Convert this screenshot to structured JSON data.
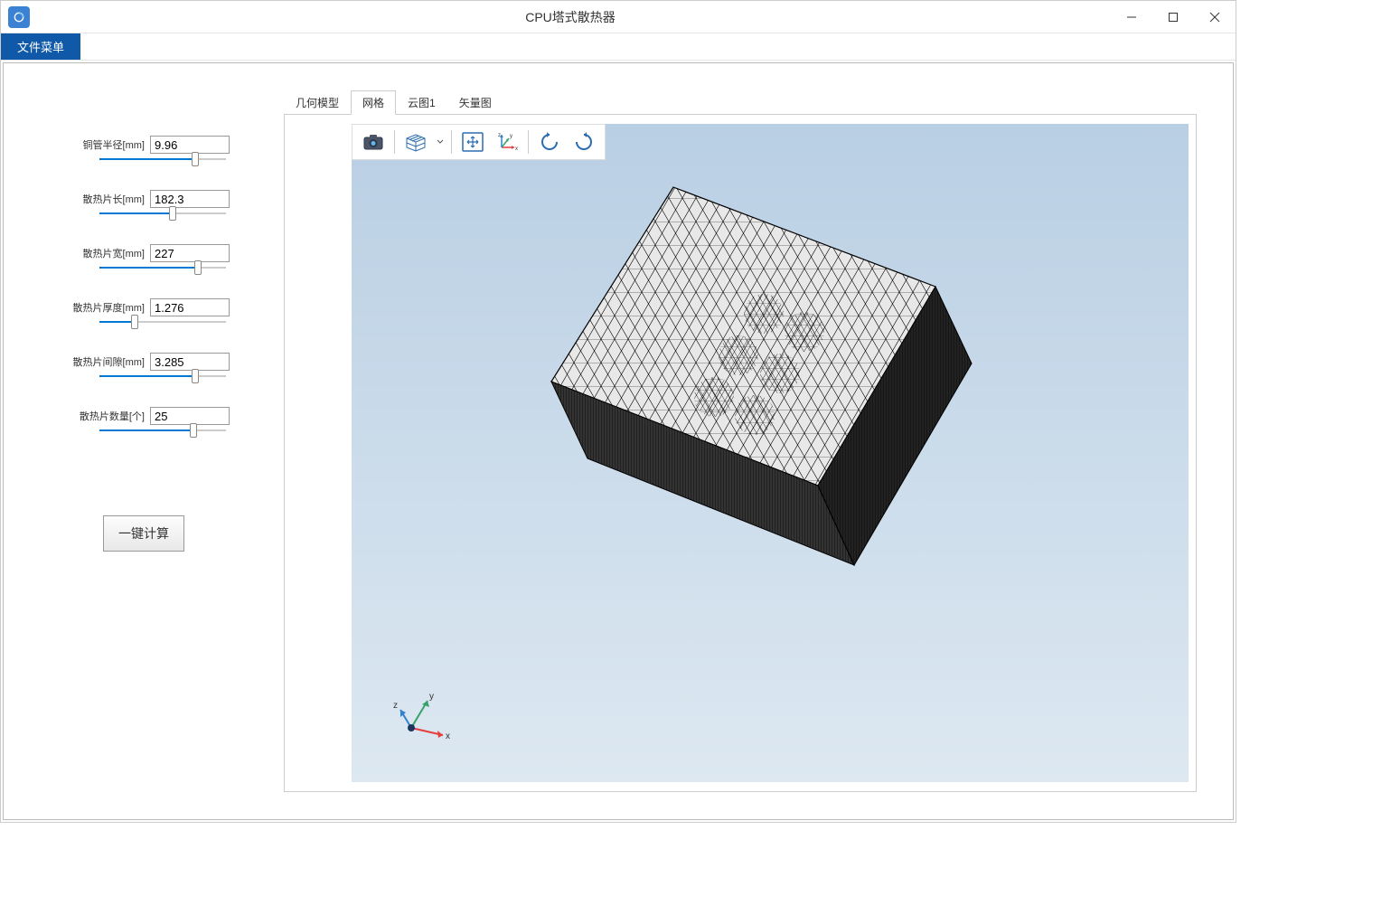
{
  "window": {
    "title": "CPU塔式散热器"
  },
  "menu": {
    "file": "文件菜单"
  },
  "params": [
    {
      "label": "铜管半径[mm]",
      "value": "9.96",
      "pct": 76
    },
    {
      "label": "散热片长[mm]",
      "value": "182.3",
      "pct": 58
    },
    {
      "label": "散热片宽[mm]",
      "value": "227",
      "pct": 78
    },
    {
      "label": "散热片厚度[mm]",
      "value": "1.276",
      "pct": 28
    },
    {
      "label": "散热片间隙[mm]",
      "value": "3.285",
      "pct": 76
    },
    {
      "label": "散热片数量[个]",
      "value": "25",
      "pct": 74
    }
  ],
  "compute_button": "一键计算",
  "tabs": [
    {
      "label": "几何模型",
      "active": false
    },
    {
      "label": "网格",
      "active": true
    },
    {
      "label": "云图1",
      "active": false
    },
    {
      "label": "矢量图",
      "active": false
    }
  ],
  "toolbar_icons": [
    "camera-icon",
    "render-mode-icon",
    "pan-icon",
    "axis-icon",
    "rotate-left-icon",
    "rotate-right-icon"
  ],
  "axis": {
    "x": "x",
    "y": "y",
    "z": "z"
  }
}
